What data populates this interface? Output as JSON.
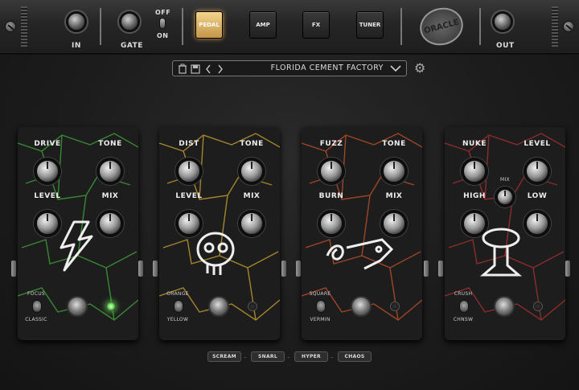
{
  "topbar": {
    "in_label": "IN",
    "gate_label": "GATE",
    "gate_off": "OFF",
    "gate_on": "ON",
    "modes": [
      "PEDAL",
      "AMP",
      "FX",
      "TUNER"
    ],
    "active_mode": "PEDAL",
    "logo_text": "ORACLE",
    "out_label": "OUT"
  },
  "preset": {
    "name": "FLORIDA CEMENT FACTORY"
  },
  "pedals": [
    {
      "knobs": [
        "DRIVE",
        "TONE",
        "LEVEL",
        "MIX"
      ],
      "switch_top": "FOCUS",
      "switch_bottom": "CLASSIC",
      "crack_color": "#3fa43a",
      "led_on": true
    },
    {
      "knobs": [
        "DIST",
        "TONE",
        "LEVEL",
        "MIX"
      ],
      "switch_top": "ORANGE",
      "switch_bottom": "YELLOW",
      "crack_color": "#c8a030",
      "led_on": false
    },
    {
      "knobs": [
        "FUZZ",
        "TONE",
        "BURN",
        "MIX"
      ],
      "switch_top": "SQUARE",
      "switch_bottom": "VERMIN",
      "crack_color": "#c0502a",
      "led_on": false
    },
    {
      "knobs": [
        "NUKE",
        "LEVEL",
        "HIGH",
        "LOW"
      ],
      "mid_knob": "MIX",
      "switch_top": "CRUSH",
      "switch_bottom": "CHNSW",
      "crack_color": "#a83030",
      "led_on": false
    }
  ],
  "chain": [
    "SCREAM",
    "SNARL",
    "HYPER",
    "CHAOS"
  ],
  "chain_sep": "–"
}
